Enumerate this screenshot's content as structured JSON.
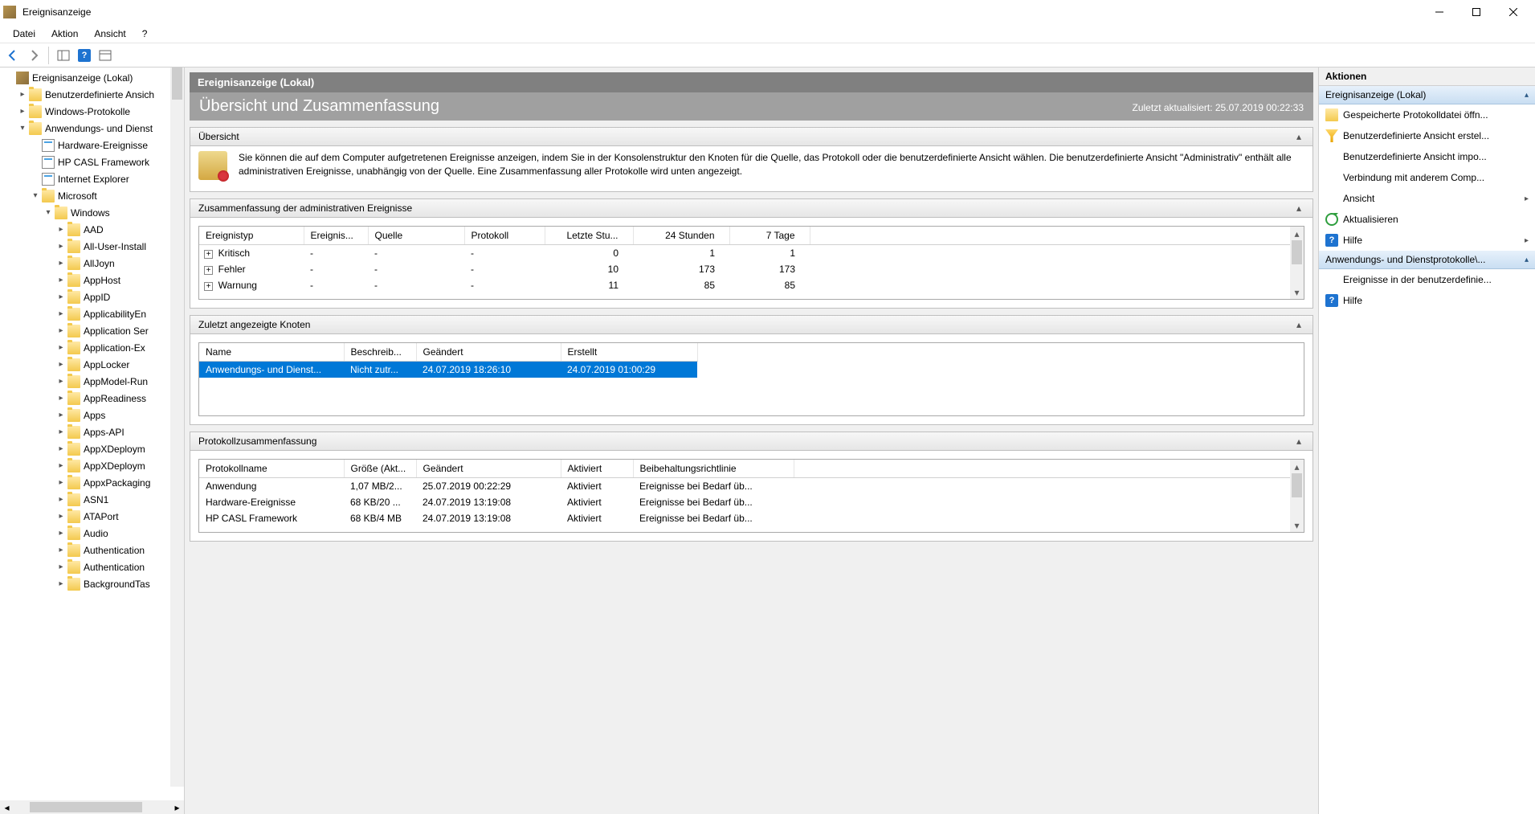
{
  "window": {
    "title": "Ereignisanzeige"
  },
  "menu": {
    "file": "Datei",
    "action": "Aktion",
    "view": "Ansicht",
    "help": "?"
  },
  "tree": {
    "root": "Ereignisanzeige (Lokal)",
    "custom_views": "Benutzerdefinierte Ansich",
    "win_logs": "Windows-Protokolle",
    "app_logs": "Anwendungs- und Dienst",
    "hw_events": "Hardware-Ereignisse",
    "hp_casl": "HP CASL Framework",
    "ie": "Internet Explorer",
    "ms": "Microsoft",
    "windows": "Windows",
    "items": [
      "AAD",
      "All-User-Install",
      "AllJoyn",
      "AppHost",
      "AppID",
      "ApplicabilityEn",
      "Application Ser",
      "Application-Ex",
      "AppLocker",
      "AppModel-Run",
      "AppReadiness",
      "Apps",
      "Apps-API",
      "AppXDeploym",
      "AppXDeploym",
      "AppxPackaging",
      "ASN1",
      "ATAPort",
      "Audio",
      "Authentication",
      "Authentication",
      "BackgroundTas"
    ]
  },
  "center": {
    "title": "Ereignisanzeige (Lokal)",
    "subtitle": "Übersicht und Zusammenfassung",
    "updated": "Zuletzt aktualisiert: 25.07.2019 00:22:33",
    "overview_hdr": "Übersicht",
    "overview_text": "Sie können die auf dem Computer aufgetretenen Ereignisse anzeigen, indem Sie in der Konsolenstruktur den Knoten für die Quelle, das Protokoll oder die benutzerdefinierte Ansicht wählen. Die benutzerdefinierte Ansicht \"Administrativ\" enthält alle administrativen Ereignisse, unabhängig von der Quelle. Eine Zusammenfassung aller Protokolle wird unten angezeigt.",
    "summary_hdr": "Zusammenfassung der administrativen Ereignisse",
    "summary_cols": {
      "type": "Ereignistyp",
      "eid": "Ereignis...",
      "source": "Quelle",
      "log": "Protokoll",
      "last_hr": "Letzte Stu...",
      "h24": "24 Stunden",
      "d7": "7 Tage"
    },
    "summary_rows": [
      {
        "type": "Kritisch",
        "eid": "-",
        "source": "-",
        "log": "-",
        "last_hr": "0",
        "h24": "1",
        "d7": "1"
      },
      {
        "type": "Fehler",
        "eid": "-",
        "source": "-",
        "log": "-",
        "last_hr": "10",
        "h24": "173",
        "d7": "173"
      },
      {
        "type": "Warnung",
        "eid": "-",
        "source": "-",
        "log": "-",
        "last_hr": "11",
        "h24": "85",
        "d7": "85"
      }
    ],
    "recent_hdr": "Zuletzt angezeigte Knoten",
    "recent_cols": {
      "name": "Name",
      "desc": "Beschreib...",
      "changed": "Geändert",
      "created": "Erstellt"
    },
    "recent_row": {
      "name": "Anwendungs- und Dienst...",
      "desc": "Nicht zutr...",
      "changed": "24.07.2019 18:26:10",
      "created": "24.07.2019 01:00:29"
    },
    "logsum_hdr": "Protokollzusammenfassung",
    "logsum_cols": {
      "name": "Protokollname",
      "size": "Größe (Akt...",
      "changed": "Geändert",
      "enabled": "Aktiviert",
      "retention": "Beibehaltungsrichtlinie"
    },
    "logsum_rows": [
      {
        "name": "Anwendung",
        "size": "1,07 MB/2...",
        "changed": "25.07.2019 00:22:29",
        "enabled": "Aktiviert",
        "retention": "Ereignisse bei Bedarf üb..."
      },
      {
        "name": "Hardware-Ereignisse",
        "size": "68 KB/20 ...",
        "changed": "24.07.2019 13:19:08",
        "enabled": "Aktiviert",
        "retention": "Ereignisse bei Bedarf üb..."
      },
      {
        "name": "HP CASL Framework",
        "size": "68 KB/4 MB",
        "changed": "24.07.2019 13:19:08",
        "enabled": "Aktiviert",
        "retention": "Ereignisse bei Bedarf üb..."
      }
    ]
  },
  "actions": {
    "title": "Aktionen",
    "group1": "Ereignisanzeige (Lokal)",
    "open_saved": "Gespeicherte Protokolldatei öffn...",
    "create_view": "Benutzerdefinierte Ansicht erstel...",
    "import_view": "Benutzerdefinierte Ansicht impo...",
    "connect": "Verbindung mit anderem Comp...",
    "view": "Ansicht",
    "refresh": "Aktualisieren",
    "help": "Hilfe",
    "group2": "Anwendungs- und Dienstprotokolle\\...",
    "events_in": "Ereignisse in der benutzerdefinie...",
    "help2": "Hilfe"
  }
}
